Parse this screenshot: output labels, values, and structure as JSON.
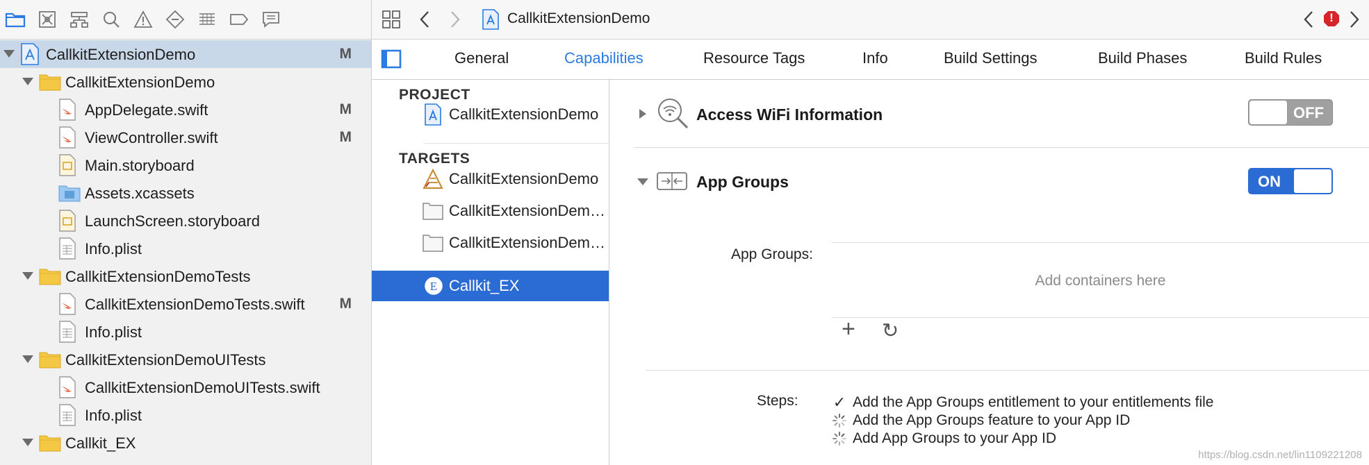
{
  "navigator": {
    "toolbar_icons": [
      "folder-icon",
      "source-control-icon",
      "hierarchy-icon",
      "search-icon",
      "warning-icon",
      "test-icon",
      "debug-icon",
      "breakpoint-icon",
      "report-icon"
    ],
    "items": [
      {
        "label": "CallkitExtensionDemo",
        "badge": "M",
        "icon": "project-icon",
        "level": 0
      },
      {
        "label": "CallkitExtensionDemo",
        "badge": "",
        "icon": "folder-icon",
        "level": 1
      },
      {
        "label": "AppDelegate.swift",
        "badge": "M",
        "icon": "swift-file-icon",
        "level": 2
      },
      {
        "label": "ViewController.swift",
        "badge": "M",
        "icon": "swift-file-icon",
        "level": 2
      },
      {
        "label": "Main.storyboard",
        "badge": "",
        "icon": "storyboard-file-icon",
        "level": 2
      },
      {
        "label": "Assets.xcassets",
        "badge": "",
        "icon": "asset-catalog-icon",
        "level": 2
      },
      {
        "label": "LaunchScreen.storyboard",
        "badge": "",
        "icon": "storyboard-file-icon",
        "level": 2
      },
      {
        "label": "Info.plist",
        "badge": "",
        "icon": "plist-file-icon",
        "level": 2
      },
      {
        "label": "CallkitExtensionDemoTests",
        "badge": "",
        "icon": "folder-icon",
        "level": 1
      },
      {
        "label": "CallkitExtensionDemoTests.swift",
        "badge": "M",
        "icon": "swift-file-icon",
        "level": 2
      },
      {
        "label": "Info.plist",
        "badge": "",
        "icon": "plist-file-icon",
        "level": 2
      },
      {
        "label": "CallkitExtensionDemoUITests",
        "badge": "",
        "icon": "folder-icon",
        "level": 1
      },
      {
        "label": "CallkitExtensionDemoUITests.swift",
        "badge": "",
        "icon": "swift-file-icon",
        "level": 2
      },
      {
        "label": "Info.plist",
        "badge": "",
        "icon": "plist-file-icon",
        "level": 2
      },
      {
        "label": "Callkit_EX",
        "badge": "",
        "icon": "folder-icon",
        "level": 1
      }
    ]
  },
  "jumpbar": {
    "title": "CallkitExtensionDemo",
    "icons": [
      "grid-icon",
      "back-icon",
      "forward-icon",
      "project-icon",
      "prev-issue-icon",
      "error-icon",
      "next-issue-icon"
    ],
    "error_glyph": "!"
  },
  "tabs": [
    "General",
    "Capabilities",
    "Resource Tags",
    "Info",
    "Build Settings",
    "Build Phases",
    "Build Rules"
  ],
  "active_tab": "Capabilities",
  "targets_panel": {
    "project_header": "PROJECT",
    "project_item": "CallkitExtensionDemo",
    "targets_header": "TARGETS",
    "targets": [
      {
        "label": "CallkitExtensionDemo",
        "icon": "app-target-icon"
      },
      {
        "label": "CallkitExtensionDemoTests",
        "icon": "test-target-icon"
      },
      {
        "label": "CallkitExtensionDemoUITests",
        "icon": "test-target-icon"
      },
      {
        "label": "Callkit_EX",
        "icon": "extension-target-icon"
      }
    ],
    "selected_target": "Callkit_EX"
  },
  "capabilities": {
    "wifi": {
      "title": "Access WiFi Information",
      "toggle_label": "OFF",
      "enabled": false
    },
    "app_groups": {
      "title": "App Groups",
      "toggle_label": "ON",
      "enabled": true,
      "field_label": "App Groups:",
      "placeholder": "Add containers here",
      "add_glyph": "+",
      "refresh_glyph": "↻"
    },
    "steps": {
      "label": "Steps:",
      "items": [
        {
          "text": "Add the App Groups entitlement to your entitlements file",
          "status": "done"
        },
        {
          "text": "Add the App Groups feature to your App ID",
          "status": "pending"
        },
        {
          "text": "Add App Groups to your App ID",
          "status": "pending"
        }
      ],
      "done_glyph": "✓"
    }
  },
  "watermark": "https://blog.csdn.net/lin1109221208",
  "colors": {
    "accent": "#2b7be2",
    "selection": "#2a6cd4",
    "error": "#d4262a",
    "navigator_selection": "#c9d8e8"
  }
}
